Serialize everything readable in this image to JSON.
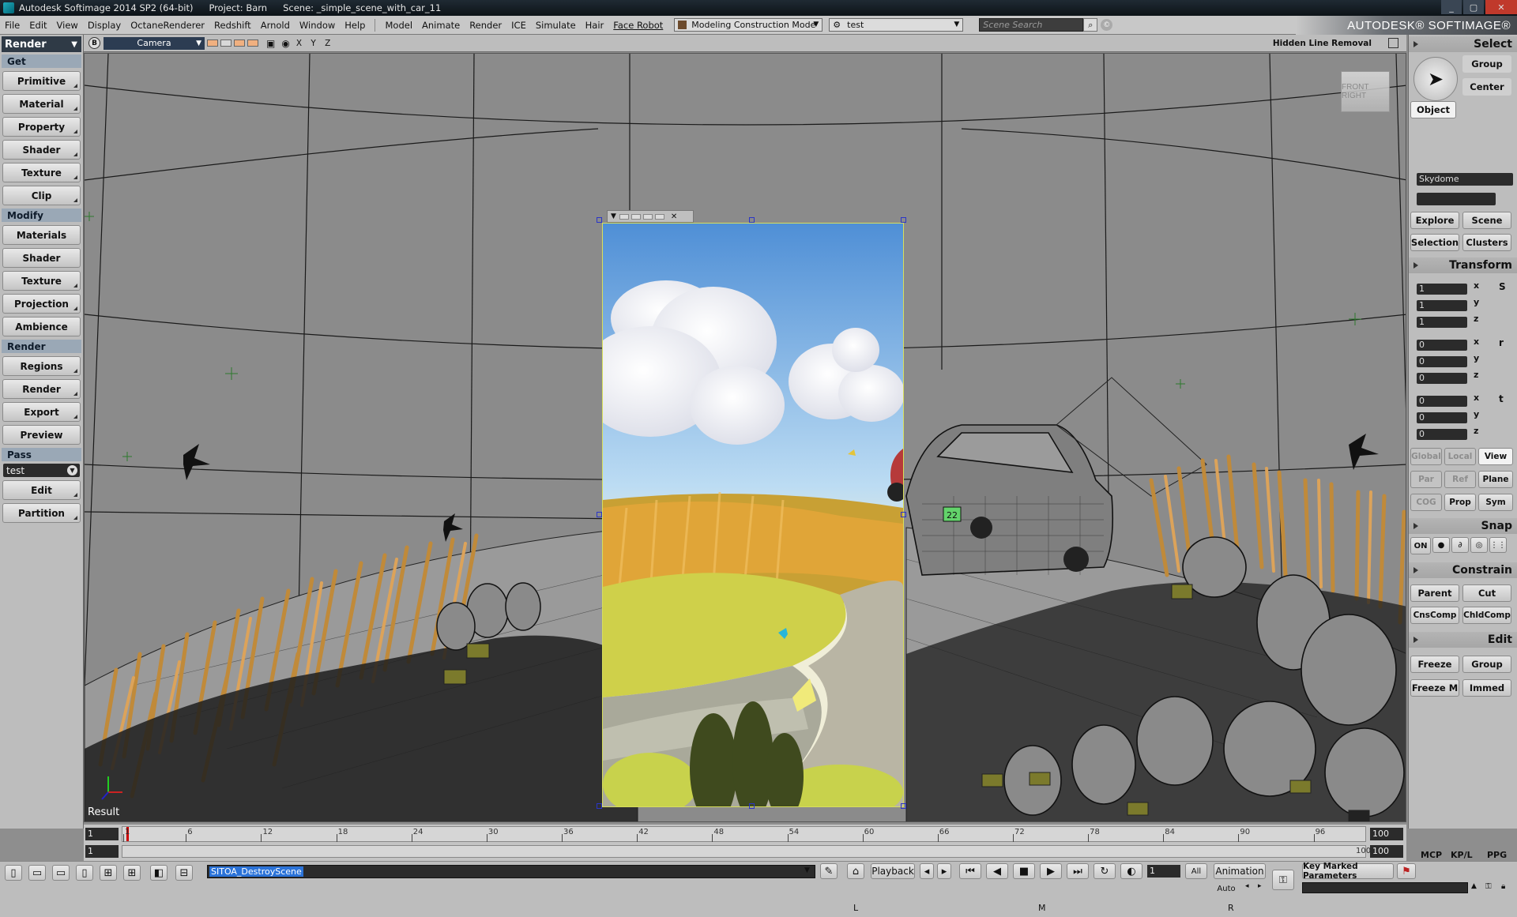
{
  "titlebar": {
    "app": "Autodesk Softimage 2014 SP2 (64-bit)",
    "project": "Project: Barn",
    "scene": "Scene: _simple_scene_with_car_11",
    "buttons": [
      "_",
      "▢",
      "✕"
    ]
  },
  "menubar": {
    "items": [
      "File",
      "Edit",
      "View",
      "Display",
      "OctaneRenderer",
      "Redshift",
      "Arnold",
      "Window",
      "Help",
      "Model",
      "Animate",
      "Render",
      "ICE",
      "Simulate",
      "Hair",
      "Face Robot"
    ],
    "mode_dropdown": "Modeling Construction Mode",
    "layer_dropdown": "test",
    "search_placeholder": "Scene Search",
    "brand": "AUTODESK® SOFTIMAGE®"
  },
  "left_panel": {
    "mode": "Render",
    "sections": [
      {
        "header": "Get",
        "buttons": [
          "Primitive",
          "Material",
          "Property",
          "Shader",
          "Texture",
          "Clip"
        ]
      },
      {
        "header": "Modify",
        "buttons": [
          "Materials",
          "Shader",
          "Texture",
          "Projection",
          "Ambience"
        ]
      },
      {
        "header": "Render",
        "buttons": [
          "Regions",
          "Render",
          "Export",
          "Preview"
        ]
      },
      {
        "header": "Pass",
        "select": "test",
        "buttons": [
          "Edit",
          "Partition"
        ]
      }
    ]
  },
  "viewport": {
    "camera": "Camera",
    "b_button": "B",
    "axes": "X Y Z",
    "display_mode": "Hidden Line Removal",
    "label": "Result",
    "navcube_face": "FRONT  RIGHT",
    "badge": "22"
  },
  "right_panel": {
    "select": {
      "header": "Select",
      "buttons": [
        "Group",
        "Center",
        "Object"
      ],
      "selection_field": "Skydome"
    },
    "explore": [
      "Explore",
      "Scene",
      "Selection",
      "Clusters"
    ],
    "transform": {
      "header": "Transform",
      "scale": [
        "1",
        "1",
        "1"
      ],
      "rotate": [
        "0",
        "0",
        "0"
      ],
      "translate": [
        "0",
        "0",
        "0"
      ],
      "axes": [
        "x",
        "y",
        "z"
      ],
      "space_row1": [
        "Global",
        "Local",
        "View"
      ],
      "space_row2": [
        "Par",
        "Ref",
        "Plane"
      ],
      "space_row3": [
        "COG",
        "Prop",
        "Sym"
      ]
    },
    "snap": {
      "header": "Snap",
      "on": "ON"
    },
    "constrain": {
      "header": "Constrain",
      "buttons": [
        "Parent",
        "Cut",
        "CnsComp",
        "ChldComp"
      ]
    },
    "edit": {
      "header": "Edit",
      "buttons": [
        "Freeze",
        "Group",
        "Freeze M",
        "Immed"
      ]
    }
  },
  "timeline": {
    "start_field": "1",
    "start_field2": "1",
    "ticks": [
      "1",
      "6",
      "12",
      "18",
      "24",
      "30",
      "36",
      "42",
      "48",
      "54",
      "60",
      "66",
      "72",
      "78",
      "84",
      "90",
      "96"
    ],
    "end_field": "100",
    "end_field2": "100",
    "end_label": "100"
  },
  "bottom": {
    "command": "SITOA_DestroyScene",
    "playback": "Playback",
    "frame": "1",
    "all": "All",
    "animation": "Animation",
    "auto": "Auto",
    "key_marked": "Key Marked Parameters",
    "tabs": [
      "MCP",
      "KP/L",
      "PPG"
    ],
    "letters": [
      "L",
      "M",
      "R"
    ]
  }
}
